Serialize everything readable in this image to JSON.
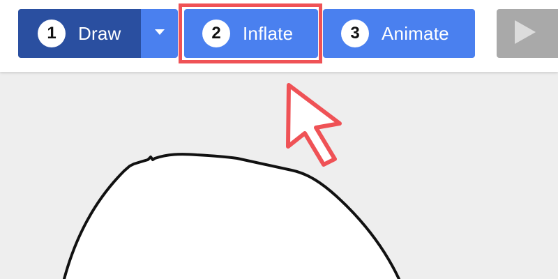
{
  "toolbar": {
    "draw": {
      "step": "1",
      "label": "Draw"
    },
    "inflate": {
      "step": "2",
      "label": "Inflate"
    },
    "animate": {
      "step": "3",
      "label": "Animate"
    },
    "dropdown_icon": "caret-down-icon",
    "play_icon": "play-icon"
  },
  "annotation": {
    "highlight_target": "inflate",
    "highlight_color": "#ef5256",
    "pointer_icon": "cursor-arrow-icon"
  },
  "colors": {
    "draw_button": "#2a4fa0",
    "primary_button": "#4a80ef",
    "disabled_button": "#a9a9a9",
    "canvas_background": "#eeeeee"
  }
}
